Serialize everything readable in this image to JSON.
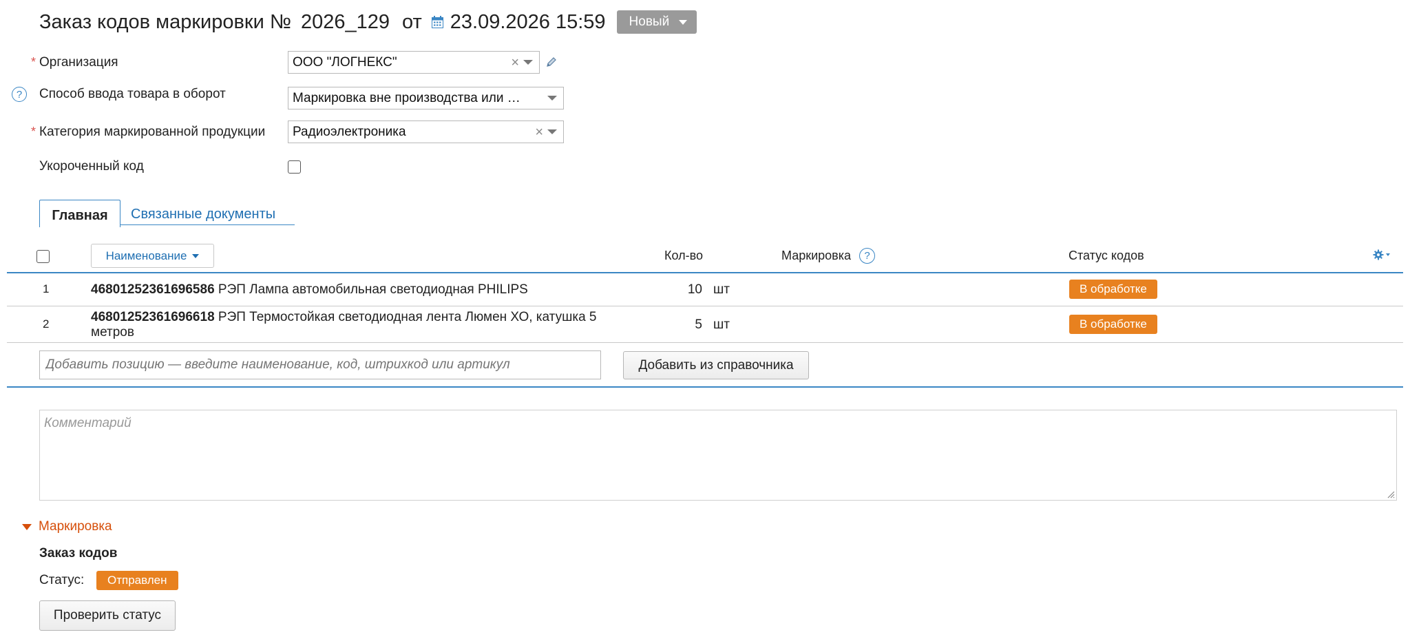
{
  "header": {
    "title": "Заказ кодов маркировки №",
    "number": "2026_129",
    "from_label": "от",
    "date": "23.09.2026 15:59",
    "status_button": "Новый"
  },
  "form": {
    "organization_label": "Организация",
    "organization_value": "ООО \"ЛОГНЕКС\"",
    "method_label": "Способ ввода товара в оборот",
    "method_value": "Маркировка вне производства или …",
    "category_label": "Категория маркированной продукции",
    "category_value": "Радиоэлектроника",
    "short_code_label": "Укороченный код",
    "short_code_checked": false,
    "required_mark": "*",
    "help_mark": "?"
  },
  "tabs": [
    {
      "label": "Главная",
      "active": true
    },
    {
      "label": "Связанные документы",
      "active": false
    }
  ],
  "table": {
    "columns": {
      "name": "Наименование",
      "qty": "Кол-во",
      "marking": "Маркировка",
      "status": "Статус кодов"
    },
    "rows": [
      {
        "num": "1",
        "code": "46801252361696586",
        "name": "РЭП Лампа автомобильная светодиодная PHILIPS",
        "qty": "10",
        "unit": "шт",
        "status": "В обработке"
      },
      {
        "num": "2",
        "code": "46801252361696618",
        "name": "РЭП Термостойкая светодиодная лента Люмен ХО, катушка 5 метров",
        "qty": "5",
        "unit": "шт",
        "status": "В обработке"
      }
    ],
    "add_placeholder": "Добавить позицию — введите наименование, код, штрихкод или артикул",
    "add_from_catalog": "Добавить из справочника"
  },
  "comment_placeholder": "Комментарий",
  "marking_section": {
    "toggle_label": "Маркировка",
    "subtitle": "Заказ кодов",
    "status_label": "Статус:",
    "status_value": "Отправлен",
    "check_button": "Проверить статус"
  },
  "colors": {
    "accent_blue": "#3a86c4",
    "link_blue": "#1f6fb2",
    "badge_orange": "#e8811f",
    "section_orange": "#d64f0b",
    "status_gray": "#9a9a9a"
  }
}
